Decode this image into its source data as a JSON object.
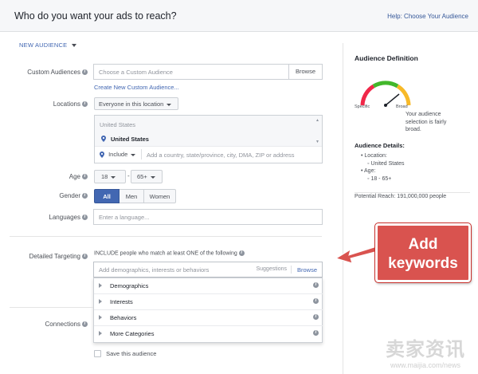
{
  "header": {
    "title": "Who do you want your ads to reach?",
    "help_link": "Help: Choose Your Audience"
  },
  "new_audience": {
    "label": "NEW AUDIENCE"
  },
  "custom_audiences": {
    "label": "Custom Audiences",
    "placeholder": "Choose a Custom Audience",
    "browse": "Browse",
    "create_link": "Create New Custom Audience..."
  },
  "locations": {
    "label": "Locations",
    "scope": "Everyone in this location",
    "group_header": "United States",
    "selected": "United States",
    "include": "Include",
    "placeholder": "Add a country, state/province, city, DMA, ZIP or address"
  },
  "age": {
    "label": "Age",
    "min": "18",
    "max": "65+",
    "sep": "-"
  },
  "gender": {
    "label": "Gender",
    "options": [
      "All",
      "Men",
      "Women"
    ],
    "selected": "All"
  },
  "languages": {
    "label": "Languages",
    "placeholder": "Enter a language..."
  },
  "detailed_targeting": {
    "label": "Detailed Targeting",
    "description": "INCLUDE people who match at least ONE of the following",
    "placeholder": "Add demographics, interests or behaviors",
    "suggestions": "Suggestions",
    "browse": "Browse",
    "categories": [
      "Demographics",
      "Interests",
      "Behaviors",
      "More Categories"
    ]
  },
  "connections": {
    "label": "Connections"
  },
  "save": {
    "label": "Save this audience"
  },
  "audience_definition": {
    "title": "Audience Definition",
    "gauge_left": "Specific",
    "gauge_right": "Broad",
    "gauge_level_fraction": 0.78,
    "gauge_text": "Your audience selection is fairly broad.",
    "details_title": "Audience Details:",
    "location_label": "Location:",
    "location_value": "United States",
    "age_label": "Age:",
    "age_value": "18 - 65+",
    "potential_reach": "Potential Reach: 191,000,000 people"
  },
  "callout": {
    "text": "Add keywords"
  },
  "watermark": {
    "brand": "卖家资讯",
    "url": "www.maijia.com/news"
  },
  "colors": {
    "accent": "#4267b2",
    "callout": "#d9534f",
    "gauge_green": "#42b72a",
    "gauge_red": "#f02849",
    "gauge_yellow": "#f7b928"
  }
}
